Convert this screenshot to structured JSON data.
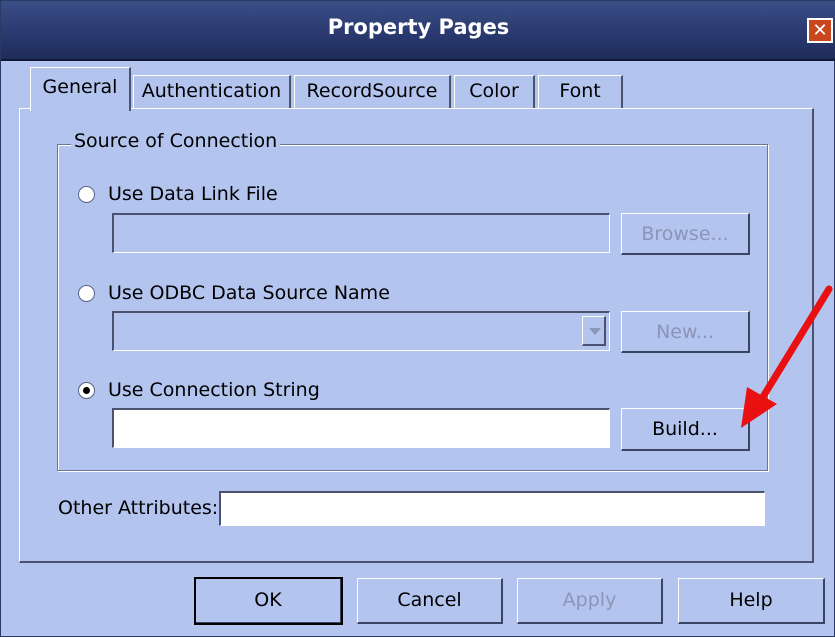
{
  "window": {
    "title": "Property Pages",
    "close_label": "✕"
  },
  "tabs": [
    {
      "label": "General",
      "active": true
    },
    {
      "label": "Authentication",
      "active": false
    },
    {
      "label": "RecordSource",
      "active": false
    },
    {
      "label": "Color",
      "active": false
    },
    {
      "label": "Font",
      "active": false
    }
  ],
  "source_group": {
    "label": "Source of Connection",
    "options": [
      {
        "label": "Use Data Link File",
        "checked": false,
        "button": "Browse...",
        "enabled": false
      },
      {
        "label": "Use ODBC Data Source Name",
        "checked": false,
        "button": "New...",
        "enabled": false
      },
      {
        "label": "Use Connection String",
        "checked": true,
        "button": "Build...",
        "enabled": true
      }
    ]
  },
  "other_attributes": {
    "label": "Other Attributes:",
    "value": ""
  },
  "buttons": {
    "ok": "OK",
    "cancel": "Cancel",
    "apply": "Apply",
    "help": "Help"
  },
  "colors": {
    "dialog_bg": "#b3c4ef",
    "titlebar": "#2a3a70",
    "annotation_arrow": "#e81010"
  }
}
